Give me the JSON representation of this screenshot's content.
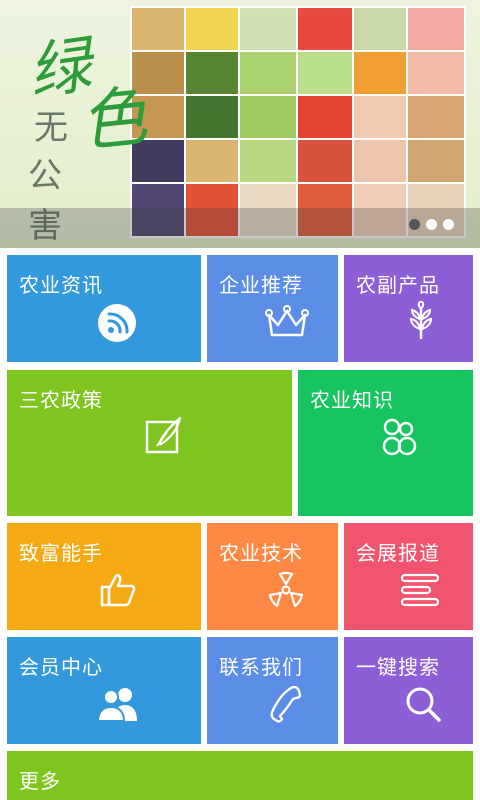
{
  "banner": {
    "title_big_1": "绿",
    "title_big_2": "色",
    "title_small_1": "无",
    "title_small_2": "公",
    "title_small_3": "害",
    "slide_count": 3,
    "active_slide": 1
  },
  "tiles": [
    {
      "label": "农业资讯",
      "icon": "rss-icon",
      "color": "#3399dd"
    },
    {
      "label": "企业推荐",
      "icon": "crown-icon",
      "color": "#5b8de6"
    },
    {
      "label": "农副产品",
      "icon": "wheat-icon",
      "color": "#8d5fd6"
    },
    {
      "label": "三农政策",
      "icon": "pen-paper-icon",
      "color": "#7fc41f"
    },
    {
      "label": "农业知识",
      "icon": "people-icon",
      "color": "#17c45f"
    },
    {
      "label": "致富能手",
      "icon": "thumbs-up-icon",
      "color": "#f5aa13"
    },
    {
      "label": "农业技术",
      "icon": "radiation-icon",
      "color": "#ff8844"
    },
    {
      "label": "会展报道",
      "icon": "list-lines-icon",
      "color": "#f0546e"
    },
    {
      "label": "会员中心",
      "icon": "users-icon",
      "color": "#3399dd"
    },
    {
      "label": "联系我们",
      "icon": "phone-icon",
      "color": "#5b8de6"
    },
    {
      "label": "一键搜索",
      "icon": "search-icon",
      "color": "#8d5fd6"
    },
    {
      "label": "更多",
      "icon": "",
      "color": "#7fc41f"
    }
  ]
}
